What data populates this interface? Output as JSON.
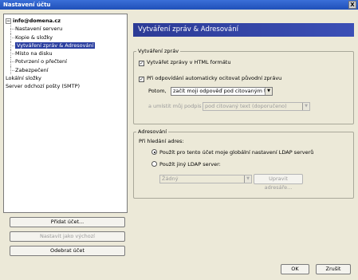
{
  "window": {
    "title": "Nastavení účtu",
    "close_label": "X"
  },
  "tree": {
    "items": [
      {
        "label": "info@domena.cz",
        "level": 0,
        "expander": "−"
      },
      {
        "label": "Nastavení serveru",
        "level": 1
      },
      {
        "label": "Kopie & složky",
        "level": 1
      },
      {
        "label": "Vytváření zpráv & Adresování",
        "level": 1,
        "selected": true
      },
      {
        "label": "Místo na disku",
        "level": 1
      },
      {
        "label": "Potvrzení o přečtení",
        "level": 1
      },
      {
        "label": "Zabezpečení",
        "level": 1
      },
      {
        "label": "Lokální složky",
        "level": 0
      },
      {
        "label": "Server odchozí pošty (SMTP)",
        "level": 0
      }
    ]
  },
  "side_buttons": {
    "add_account": "Přidat účet...",
    "set_default": "Nastavit jako výchozí",
    "remove_account": "Odebrat účet"
  },
  "panel": {
    "title": "Vytváření zpráv & Adresování",
    "compose": {
      "legend": "Vytváření zpráv",
      "html_label": "Vytvářet zprávy v HTML formátu",
      "html_checked": true,
      "quote_label": "Při odpovídání automaticky ocitovat původní zprávu",
      "quote_checked": true,
      "then_label": "Potom,",
      "then_value": "začít moji odpověď pod citovaným textem",
      "sig_label": "a umístit můj podpis",
      "sig_value": "pod citovaný text (doporučeno)"
    },
    "addressing": {
      "legend": "Adresování",
      "lookup_label": "Při hledání adres:",
      "global_ldap_label": "Použít pro tento účet moje globální nastavení LDAP serverů",
      "global_ldap_selected": true,
      "other_ldap_label": "Použít jiný LDAP server:",
      "other_ldap_selected": false,
      "server_value": "Žádný",
      "edit_dirs_label": "Upravit adresáře..."
    }
  },
  "footer": {
    "ok_label": "OK",
    "cancel_label": "Zrušit"
  }
}
